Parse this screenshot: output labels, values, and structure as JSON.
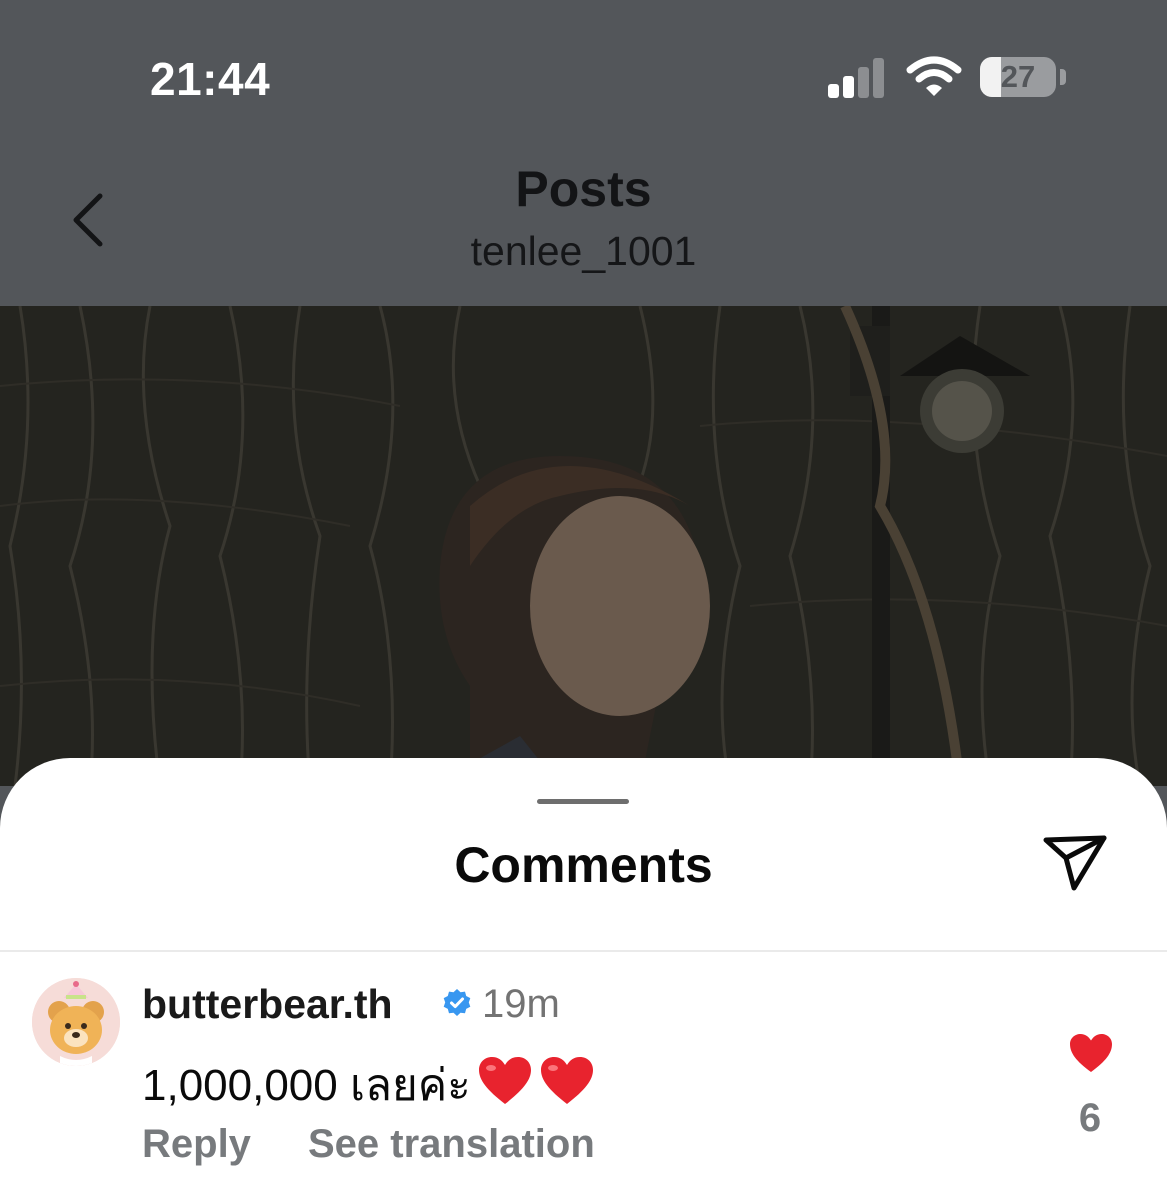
{
  "status_bar": {
    "time": "21:44",
    "battery_level": "27",
    "battery_fraction": 0.27
  },
  "header": {
    "title": "Posts",
    "username": "tenlee_1001",
    "back_icon": "chevron-left-icon"
  },
  "comments_sheet": {
    "title": "Comments",
    "share_icon": "send-icon"
  },
  "comments": [
    {
      "username": "butterbear.th",
      "verified": true,
      "time": "19m",
      "text": "1,000,000 เลยค่ะ",
      "emojis": [
        "red-heart",
        "red-heart"
      ],
      "reply_label": "Reply",
      "translate_label": "See translation",
      "like_count": "6",
      "liked": true
    }
  ],
  "colors": {
    "overlay_gray": "#53565a",
    "like_red": "#e8232e",
    "verified_blue": "#3897f0",
    "secondary_text": "#777a7d"
  }
}
